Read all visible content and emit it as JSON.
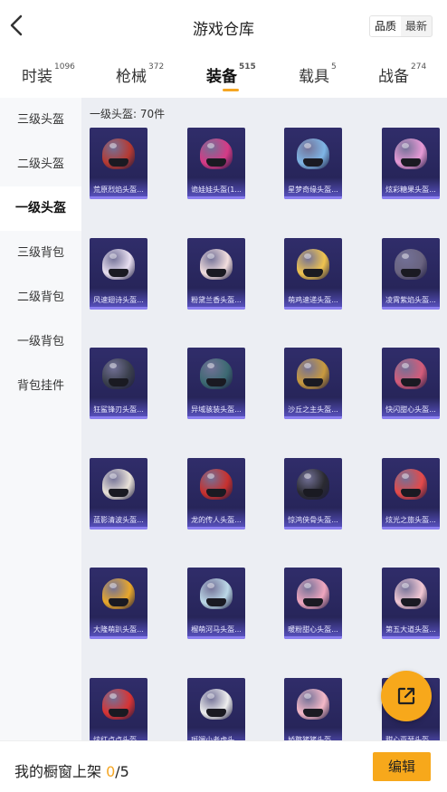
{
  "header": {
    "title": "游戏仓库",
    "sort_quality": "品质",
    "sort_newest": "最新"
  },
  "tabs": [
    {
      "label": "时装",
      "count": "1096"
    },
    {
      "label": "枪械",
      "count": "372"
    },
    {
      "label": "装备",
      "count": "515"
    },
    {
      "label": "载具",
      "count": "5"
    },
    {
      "label": "战备",
      "count": "274"
    }
  ],
  "sidebar": {
    "items": [
      {
        "label": "三级头盔"
      },
      {
        "label": "二级头盔"
      },
      {
        "label": "一级头盔"
      },
      {
        "label": "三级背包"
      },
      {
        "label": "二级背包"
      },
      {
        "label": "一级背包"
      },
      {
        "label": "背包挂件"
      }
    ]
  },
  "section": {
    "title": "一级头盔: 70件"
  },
  "items": [
    {
      "name": "荒原烈焰头盔...",
      "color": "#b63a32"
    },
    {
      "name": "诡娃娃头盔(1...",
      "color": "#d63a86"
    },
    {
      "name": "星梦奇缘头盔...",
      "color": "#7fb6e6"
    },
    {
      "name": "炫彩糖果头盔...",
      "color": "#e79ad6"
    },
    {
      "name": "风速翅诗头盔...",
      "color": "#e8dff0"
    },
    {
      "name": "粉黛兰香头盔...",
      "color": "#f2dede"
    },
    {
      "name": "萌鸡速递头盔...",
      "color": "#f0c44f"
    },
    {
      "name": "凌霄紫焰头盔...",
      "color": "#6a6480"
    },
    {
      "name": "狂鲨锋刃头盔...",
      "color": "#3a3f4c"
    },
    {
      "name": "异域骇装头盔...",
      "color": "#3c6a72"
    },
    {
      "name": "沙丘之主头盔...",
      "color": "#c99a3e"
    },
    {
      "name": "快闪甜心头盔...",
      "color": "#d45c7a"
    },
    {
      "name": "蓝影清波头盔...",
      "color": "#e9e2d8"
    },
    {
      "name": "龙的传人头盔...",
      "color": "#c8312e"
    },
    {
      "name": "惊鸿侠骨头盔...",
      "color": "#2a2a30"
    },
    {
      "name": "炫光之旅头盔...",
      "color": "#e44a4a"
    },
    {
      "name": "大隆萌趴头盔...",
      "color": "#e9a72a"
    },
    {
      "name": "榴萌河马头盔...",
      "color": "#bcd9e8"
    },
    {
      "name": "暖粉甜心头盔...",
      "color": "#f0a7bf"
    },
    {
      "name": "第五大道头盔...",
      "color": "#f2c8d4"
    },
    {
      "name": "炫红点点头盔...",
      "color": "#d83434"
    },
    {
      "name": "斑斓小老虎头...",
      "color": "#eeeeee"
    },
    {
      "name": "娇憨猪猪头盔...",
      "color": "#f5b9c8"
    },
    {
      "name": "甜心亚瑟头盔...",
      "color": "#c54a5e"
    }
  ],
  "footer": {
    "label": "我的橱窗上架 ",
    "current": "0",
    "max": "/5",
    "edit": "编辑"
  },
  "icons": {
    "back": "chevron-left-icon",
    "share": "share-external-icon"
  },
  "colors": {
    "accent": "#f7a81b",
    "card_bg": "#2c2a63",
    "content_bg": "#eceef3"
  }
}
